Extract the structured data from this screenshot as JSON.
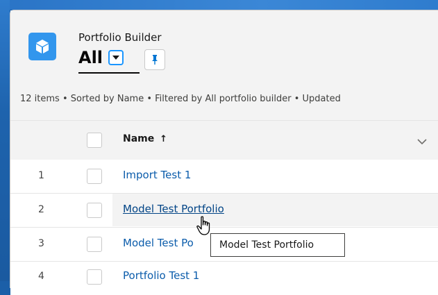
{
  "header": {
    "object_label": "Portfolio Builder",
    "list_view_name": "All",
    "icon": "cube-icon",
    "pin_icon": "pin-icon",
    "dropdown_icon": "chevron-down-icon"
  },
  "list_info": "12 items • Sorted by Name • Filtered by All portfolio builder • Updated",
  "table": {
    "columns": {
      "name_label": "Name",
      "sort_icon": "arrow-up-icon"
    },
    "rows": [
      {
        "num": "1",
        "name": "Import Test 1"
      },
      {
        "num": "2",
        "name": "Model Test Portfolio"
      },
      {
        "num": "3",
        "name": "Model Test Po"
      },
      {
        "num": "4",
        "name": "Portfolio Test 1"
      }
    ]
  },
  "tooltip": "Model Test Portfolio",
  "colors": {
    "brand": "#1b96ff",
    "link": "#0b5cab",
    "app_icon": "#3296ed"
  }
}
